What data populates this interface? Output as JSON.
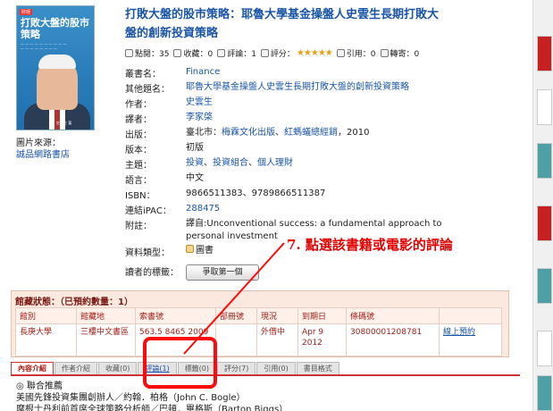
{
  "book": {
    "cover_title": "打敗大盤的股市策略",
    "cover_badge": "財經",
    "cover_author": "史雲生 著",
    "title": "打敗大盤的股市策略：耶魯大學基金操盤人史雲生長期打敗大盤的創新投資策略"
  },
  "image_source": {
    "label": "圖片來源：",
    "link": "誠品網路書店"
  },
  "stats": {
    "clicks": "點閱：35",
    "favorites": "收藏：0",
    "comments": "評論：1",
    "rating_label": "評分：",
    "rating_stars": "★★★★★",
    "citations": "引用：0",
    "shares": "轉寄：0"
  },
  "meta": {
    "series": {
      "label": "叢書名：",
      "value": "Finance"
    },
    "alt_title": {
      "label": "其他題名：",
      "value": "耶魯大學基金操盤人史雲生長期打敗大盤的創新投資策略"
    },
    "author": {
      "label": "作者：",
      "value": "史雲生"
    },
    "translator": {
      "label": "譯者：",
      "value": "李家棨"
    },
    "publisher": {
      "label": "出版：",
      "prefix": "臺北市：",
      "pub1": "梅霖文化出版",
      "sep": "、",
      "pub2": "紅螞蟻總經銷",
      "year": "，2010"
    },
    "edition": {
      "label": "版本：",
      "value": "初版"
    },
    "subjects": {
      "label": "主題：",
      "s1": "投資",
      "s2": "投資組合",
      "s3": "個人理財",
      "sep": "、"
    },
    "language": {
      "label": "語言：",
      "value": "中文"
    },
    "isbn": {
      "label": "ISBN：",
      "value": "9866511383、9789866511387"
    },
    "ipac": {
      "label": "連結iPAC：",
      "value": "288475"
    },
    "note": {
      "label": "附註：",
      "value": "譯自:Unconventional success: a fundamental approach to personal investment"
    },
    "type": {
      "label": "資料類型：",
      "value": "圖書"
    },
    "tags": {
      "label": "讀者的標籤：",
      "button": "爭取第一個"
    }
  },
  "annotation": "7. 點選該書籍或電影的評論",
  "holdings": {
    "header": "館藏狀態：（已預約數量：1）",
    "columns": [
      "館別",
      "館藏地",
      "索書號",
      "部冊號",
      "現況",
      "到期日",
      "條碼號",
      ""
    ],
    "row": [
      "長庚大學",
      "三樓中文書區",
      "563.5 8465 2009",
      "",
      "外借中",
      "Apr 9 2012",
      "30800001208781",
      "線上預約"
    ]
  },
  "tabs": [
    "內容介紹",
    "作者介紹",
    "收藏(0)",
    "評論(1)",
    "標籤(0)",
    "評分(7)",
    "引用(0)",
    "書目格式"
  ],
  "content": {
    "line1": "◎ 聯合推薦",
    "line2": "美國先鋒投資集團創辦人／約翰．柏格（John C. Bogle）",
    "line3": "摩根士丹利前首席全球策略分析師／巴頓．畢格斯（Barton Biggs）"
  },
  "colors": {
    "link": "#1a55a7",
    "annotation": "#e30000",
    "holdings_bg": "#fbe9df"
  }
}
